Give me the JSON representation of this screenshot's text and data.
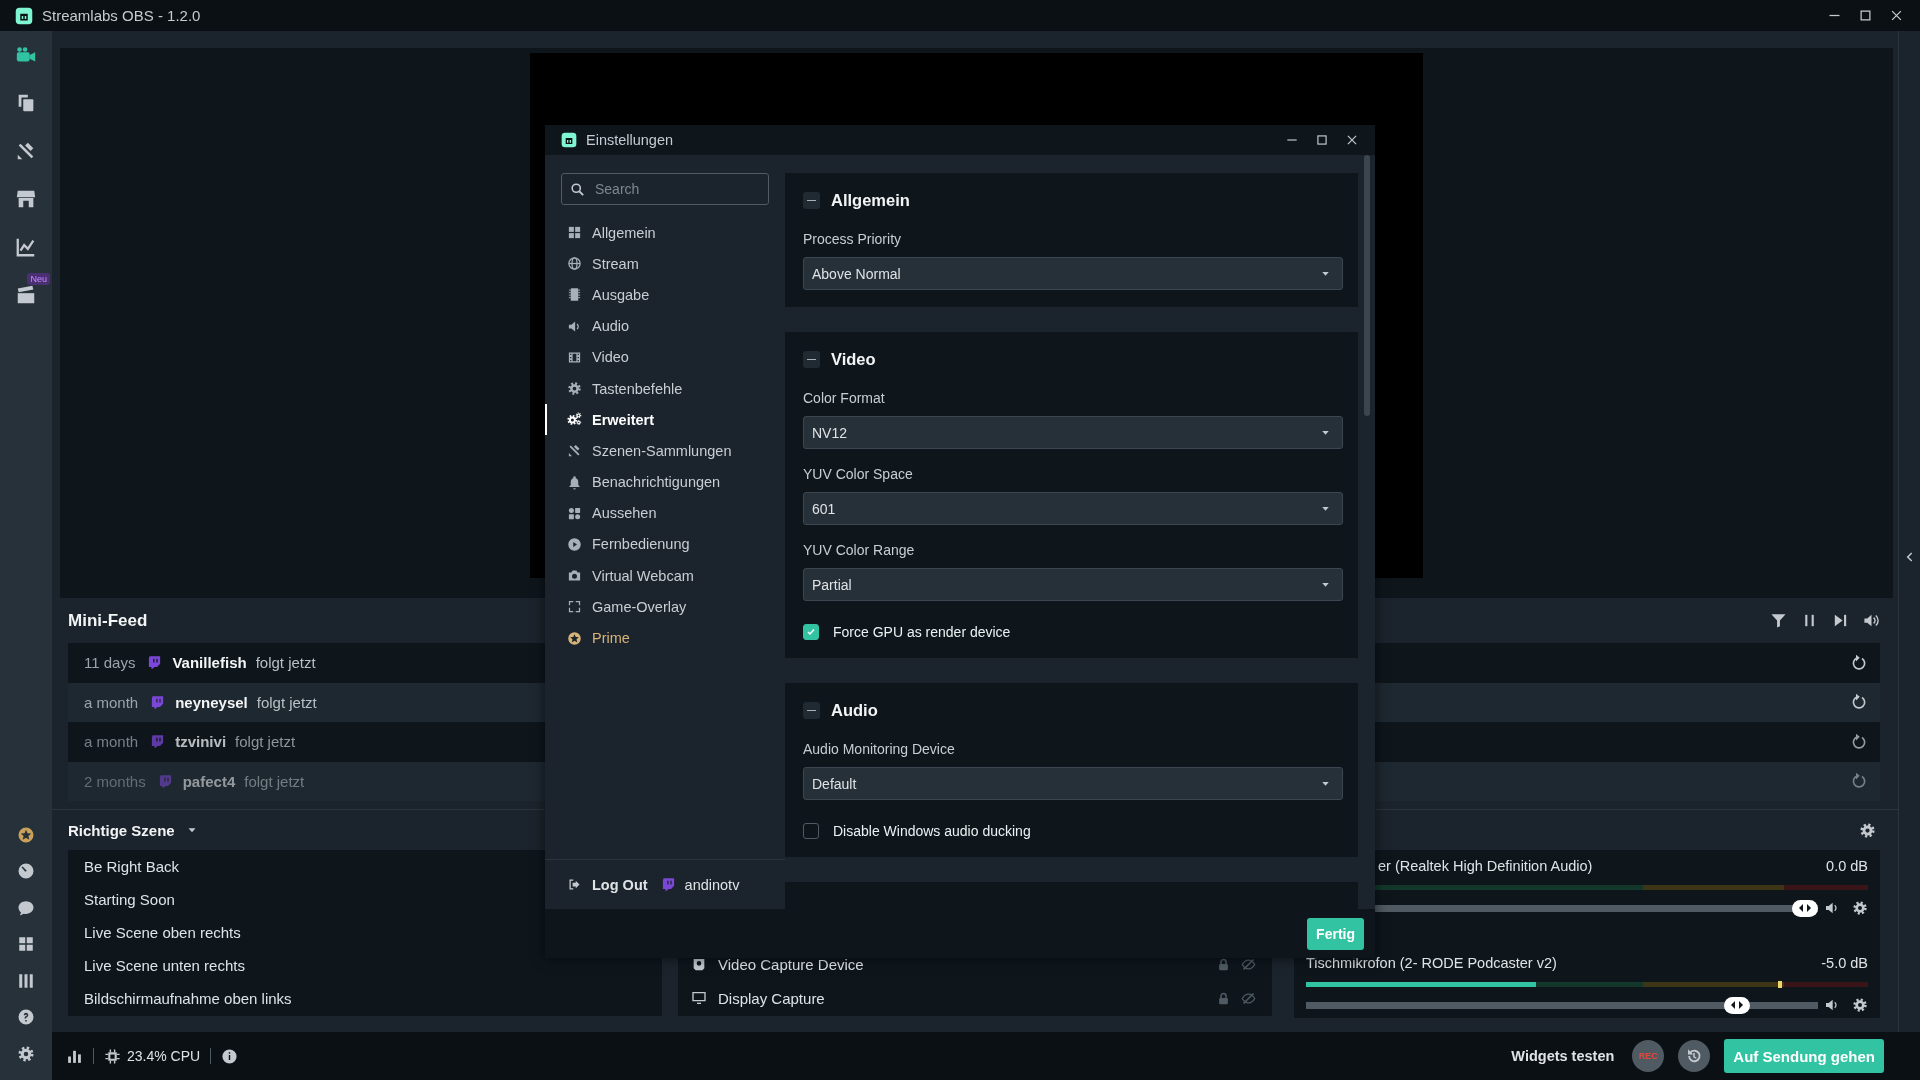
{
  "window": {
    "title": "Streamlabs OBS - 1.2.0"
  },
  "sidebar": {
    "items": [
      {
        "selected": true
      },
      {
        "selected": false
      },
      {
        "selected": false
      },
      {
        "selected": false
      },
      {
        "selected": false
      },
      {
        "selected": false,
        "badge": "Neu"
      }
    ]
  },
  "mini_feed": {
    "title": "Mini-Feed",
    "events": [
      {
        "time": "11 days",
        "user": "Vanillefish",
        "action": "folgt jetzt"
      },
      {
        "time": "a month",
        "user": "neyneysel",
        "action": "folgt jetzt"
      },
      {
        "time": "a month",
        "user": "tzvinivi",
        "action": "folgt jetzt"
      },
      {
        "time": "2 months",
        "user": "pafect4",
        "action": "folgt jetzt"
      }
    ]
  },
  "scenes": {
    "collection": "Richtige Szene",
    "items": [
      "Be Right Back",
      "Starting Soon",
      "Live Scene oben rechts",
      "Live Scene unten rechts",
      "Bildschirmaufnahme oben links"
    ]
  },
  "sources": {
    "items": [
      {
        "kind": "camera",
        "name": "Video Capture Device"
      },
      {
        "kind": "display",
        "name": "Display Capture"
      }
    ]
  },
  "mixer": {
    "channels": [
      {
        "name": "er (Realtek High Definition Audio)",
        "reading": "0.0 dB",
        "volume": {
          "level": 1
        }
      },
      {
        "name": "Tischmikrofon (2- RODE Podcaster v2)",
        "reading": "-5.0 dB",
        "meter": {
          "level": 0.41
        },
        "peak": {
          "level": 0.84
        },
        "volume": {
          "level": 0.86
        }
      }
    ]
  },
  "status_bar": {
    "cpu": "23.4% CPU",
    "test_widgets": "Widgets testen",
    "rec": "REC",
    "go_live": "Auf Sendung gehen"
  },
  "dialog": {
    "title": "Einstellungen",
    "search": {
      "placeholder": "Search"
    },
    "nav": [
      {
        "label": "Allgemein",
        "selected": false,
        "kind": "page"
      },
      {
        "label": "Stream",
        "selected": false,
        "kind": "page"
      },
      {
        "label": "Ausgabe",
        "selected": false,
        "kind": "page"
      },
      {
        "label": "Audio",
        "selected": false,
        "kind": "page"
      },
      {
        "label": "Video",
        "selected": false,
        "kind": "page"
      },
      {
        "label": "Tastenbefehle",
        "selected": false,
        "kind": "page"
      },
      {
        "label": "Erweitert",
        "selected": true,
        "kind": "page"
      },
      {
        "label": "Szenen-Sammlungen",
        "selected": false,
        "kind": "page"
      },
      {
        "label": "Benachrichtigungen",
        "selected": false,
        "kind": "page"
      },
      {
        "label": "Aussehen",
        "selected": false,
        "kind": "page"
      },
      {
        "label": "Fernbedienung",
        "selected": false,
        "kind": "page"
      },
      {
        "label": "Virtual Webcam",
        "selected": false,
        "kind": "page"
      },
      {
        "label": "Game-Overlay",
        "selected": false,
        "kind": "page"
      },
      {
        "label": "Prime",
        "selected": false,
        "kind": "prime"
      }
    ],
    "logout": "Log Out",
    "account": "andinotv",
    "sections": [
      {
        "title": "Allgemein",
        "expanded": true,
        "fields": [
          {
            "kind": "select",
            "label": "Process Priority",
            "value": "Above Normal"
          }
        ]
      },
      {
        "title": "Video",
        "expanded": true,
        "fields": [
          {
            "kind": "select",
            "label": "Color Format",
            "value": "NV12"
          },
          {
            "kind": "select",
            "label": "YUV Color Space",
            "value": "601"
          },
          {
            "kind": "select",
            "label": "YUV Color Range",
            "value": "Partial"
          },
          {
            "kind": "checkbox",
            "label": "Force GPU as render device",
            "checked": true
          }
        ]
      },
      {
        "title": "Audio",
        "expanded": true,
        "fields": [
          {
            "kind": "select",
            "label": "Audio Monitoring Device",
            "value": "Default"
          },
          {
            "kind": "checkbox",
            "label": "Disable Windows audio ducking",
            "checked": false
          }
        ]
      }
    ],
    "done": "Fertig"
  }
}
